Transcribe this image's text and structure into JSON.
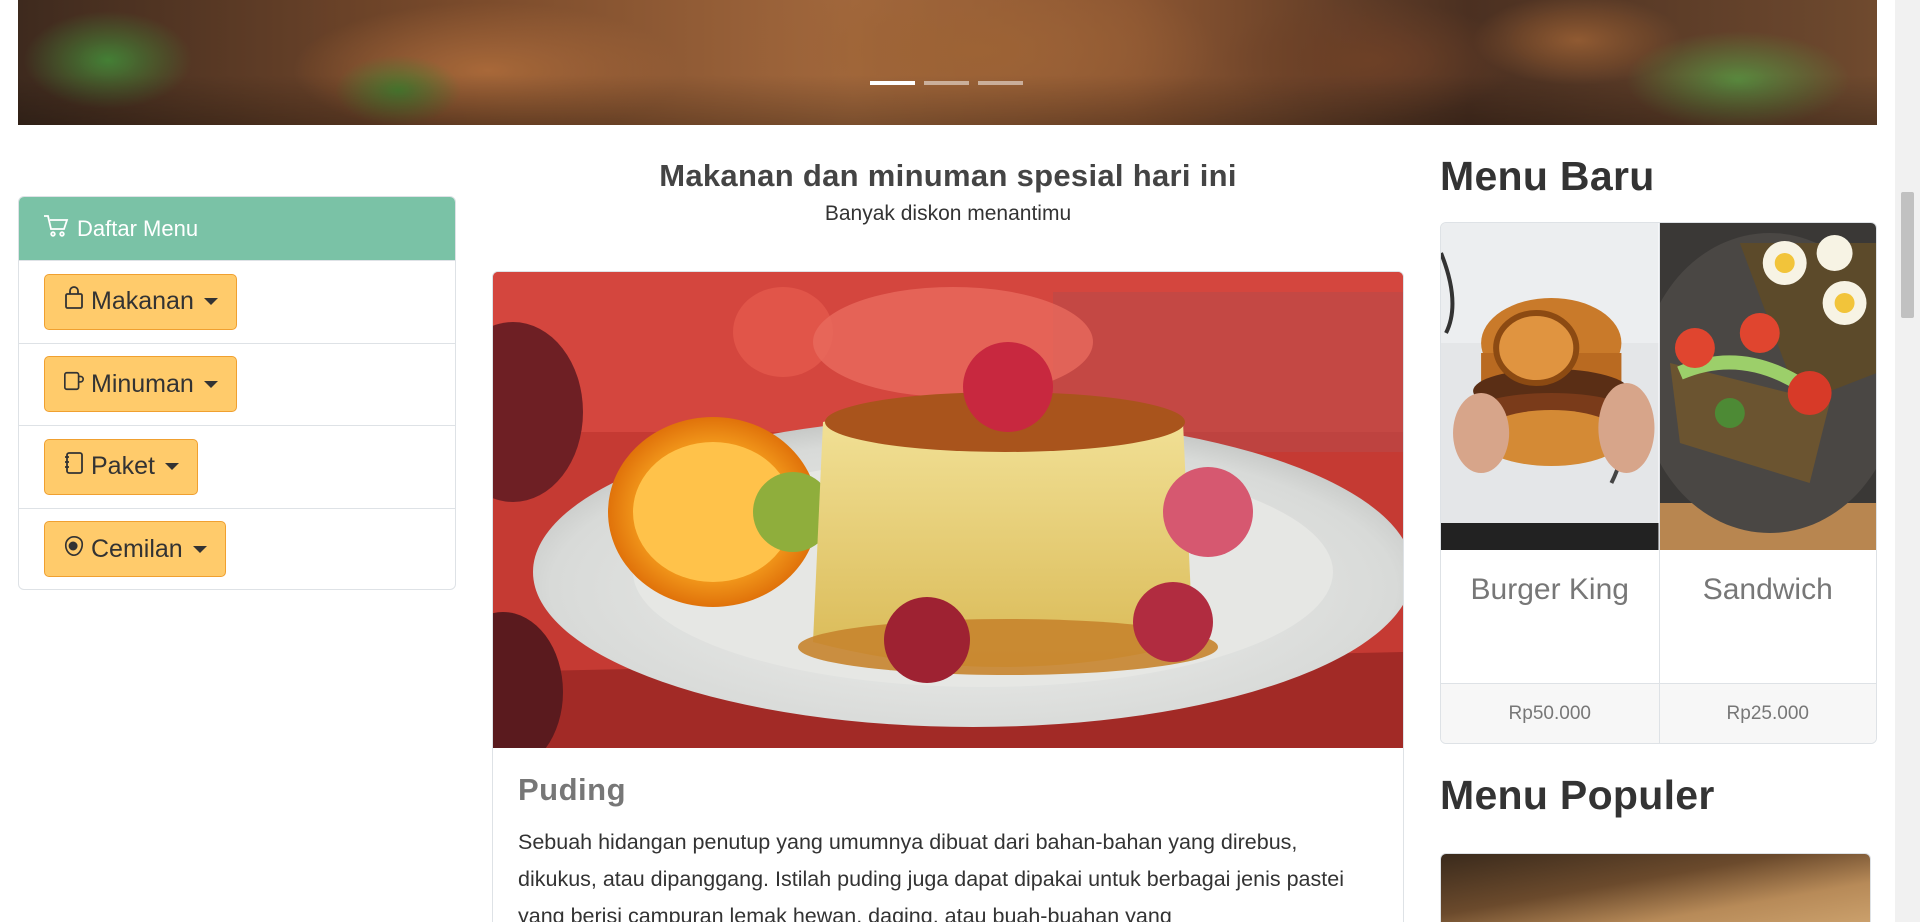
{
  "carousel": {
    "slides": 3,
    "active_index": 0
  },
  "sidebar": {
    "header_icon": "cart-icon",
    "header_label": "Daftar Menu",
    "items": [
      {
        "label": "Makanan",
        "icon": "bag-icon"
      },
      {
        "label": "Minuman",
        "icon": "cup-icon"
      },
      {
        "label": "Paket",
        "icon": "notebook-icon"
      },
      {
        "label": "Cemilan",
        "icon": "egg-icon"
      }
    ]
  },
  "main": {
    "title": "Makanan dan minuman spesial hari ini",
    "subtitle": "Banyak diskon menantimu",
    "featured": {
      "name": "Puding",
      "description": "Sebuah hidangan penutup yang umumnya dibuat dari bahan-bahan yang direbus, dikukus, atau dipanggang. Istilah puding juga dapat dipakai untuk berbagai jenis pastei yang berisi campuran lemak hewan, daging, atau buah-buahan yang"
    }
  },
  "new_menu": {
    "title": "Menu Baru",
    "items": [
      {
        "name": "Burger King",
        "price": "Rp50.000"
      },
      {
        "name": "Sandwich",
        "price": "Rp25.000"
      }
    ]
  },
  "popular_menu": {
    "title": "Menu Populer"
  },
  "colors": {
    "sidebar_header": "#7ac2a6",
    "menu_button": "#ffcb6b",
    "menu_button_border": "#f0a030"
  }
}
